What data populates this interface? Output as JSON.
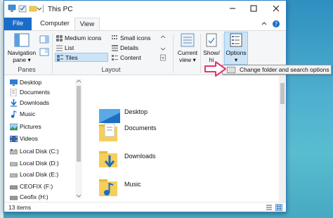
{
  "window": {
    "title": "This PC"
  },
  "tabs": {
    "file": "File",
    "computer": "Computer",
    "view": "View"
  },
  "ribbon": {
    "panes": {
      "navigation_pane": "Navigation",
      "navigation_pane_line2": "pane ▾",
      "group_label": "Panes"
    },
    "layout": {
      "group_label": "Layout",
      "items": [
        "Medium icons",
        "Small icons",
        "List",
        "Details",
        "Tiles",
        "Content"
      ],
      "selected": "Tiles"
    },
    "current_view": {
      "label": "Current",
      "label_line2": "view ▾"
    },
    "show_hide": {
      "label": "Show/",
      "label_line2": "hi"
    },
    "options": {
      "label": "Options"
    }
  },
  "menu": {
    "change_folder_options": "Change folder and search options"
  },
  "nav": {
    "items": [
      {
        "label": "Desktop",
        "icon": "desktop-icon"
      },
      {
        "label": "Documents",
        "icon": "documents-icon"
      },
      {
        "label": "Downloads",
        "icon": "downloads-icon"
      },
      {
        "label": "Music",
        "icon": "music-icon"
      },
      {
        "label": "Pictures",
        "icon": "pictures-icon"
      },
      {
        "label": "Videos",
        "icon": "videos-icon"
      },
      {
        "label": "Local Disk (C:)",
        "icon": "drive-icon"
      },
      {
        "label": "Local Disk (D:)",
        "icon": "drive-icon"
      },
      {
        "label": "Local Disk (E:)",
        "icon": "drive-icon"
      },
      {
        "label": "CEOFIX (F:)",
        "icon": "usb-drive-icon"
      },
      {
        "label": "Ceofix (H:)",
        "icon": "usb-drive-icon"
      }
    ]
  },
  "content": {
    "tiles": [
      "Desktop",
      "Documents",
      "Downloads",
      "Music"
    ]
  },
  "status": {
    "item_count": "13 items"
  },
  "colors": {
    "accent": "#1a6dc7",
    "selection": "#cce4f7",
    "annotation": "#e8326e"
  }
}
